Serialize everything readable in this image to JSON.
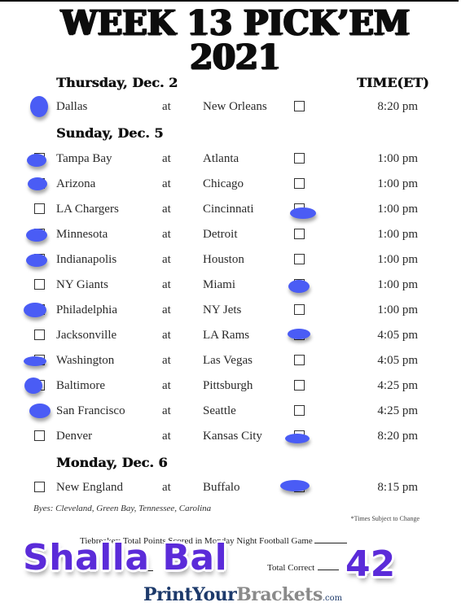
{
  "title": {
    "line1": "WEEK 13 PICK’EM",
    "line2": "2021"
  },
  "time_header": "TIME(ET)",
  "days": [
    {
      "label": "Thursday, Dec. 2",
      "games": [
        {
          "away": "Dallas",
          "sep": "at",
          "home": "New Orleans",
          "time": "8:20 pm",
          "pick": "away"
        }
      ]
    },
    {
      "label": "Sunday, Dec. 5",
      "games": [
        {
          "away": "Tampa Bay",
          "sep": "at",
          "home": "Atlanta",
          "time": "1:00 pm",
          "pick": "away"
        },
        {
          "away": "Arizona",
          "sep": "at",
          "home": "Chicago",
          "time": "1:00 pm",
          "pick": "away"
        },
        {
          "away": "LA Chargers",
          "sep": "at",
          "home": "Cincinnati",
          "time": "1:00 pm",
          "pick": "home"
        },
        {
          "away": "Minnesota",
          "sep": "at",
          "home": "Detroit",
          "time": "1:00 pm",
          "pick": "away"
        },
        {
          "away": "Indianapolis",
          "sep": "at",
          "home": "Houston",
          "time": "1:00 pm",
          "pick": "away"
        },
        {
          "away": "NY Giants",
          "sep": "at",
          "home": "Miami",
          "time": "1:00 pm",
          "pick": "home"
        },
        {
          "away": "Philadelphia",
          "sep": "at",
          "home": "NY Jets",
          "time": "1:00 pm",
          "pick": "away"
        },
        {
          "away": "Jacksonville",
          "sep": "at",
          "home": "LA Rams",
          "time": "4:05 pm",
          "pick": "home"
        },
        {
          "away": "Washington",
          "sep": "at",
          "home": "Las Vegas",
          "time": "4:05 pm",
          "pick": "away"
        },
        {
          "away": "Baltimore",
          "sep": "at",
          "home": "Pittsburgh",
          "time": "4:25 pm",
          "pick": "away"
        },
        {
          "away": "San Francisco",
          "sep": "at",
          "home": "Seattle",
          "time": "4:25 pm",
          "pick": "away"
        },
        {
          "away": "Denver",
          "sep": "at",
          "home": "Kansas City",
          "time": "8:20 pm",
          "pick": "home"
        }
      ]
    },
    {
      "label": "Monday, Dec. 6",
      "games": [
        {
          "away": "New England",
          "sep": "at",
          "home": "Buffalo",
          "time": "8:15 pm",
          "pick": "home"
        }
      ]
    }
  ],
  "byes": "Byes: Cleveland, Green Bay, Tennessee, Carolina",
  "times_note": "*Times Subject to Change",
  "tiebreaker_label": "Tiebreaker: Total Points Scored in Monday Night Football Game",
  "total_correct_label": "Total Correct",
  "handwritten": {
    "name": "Shalla Bal",
    "score": "42"
  },
  "brand": {
    "part1": "PrintYour",
    "part2": "Brackets",
    "part3": ".com"
  },
  "colors": {
    "pick_mark": "#4a5cf5",
    "handwriting": "#5b2bd9",
    "brand_dark": "#1d3a6b",
    "brand_gray": "#8a8a8a"
  }
}
